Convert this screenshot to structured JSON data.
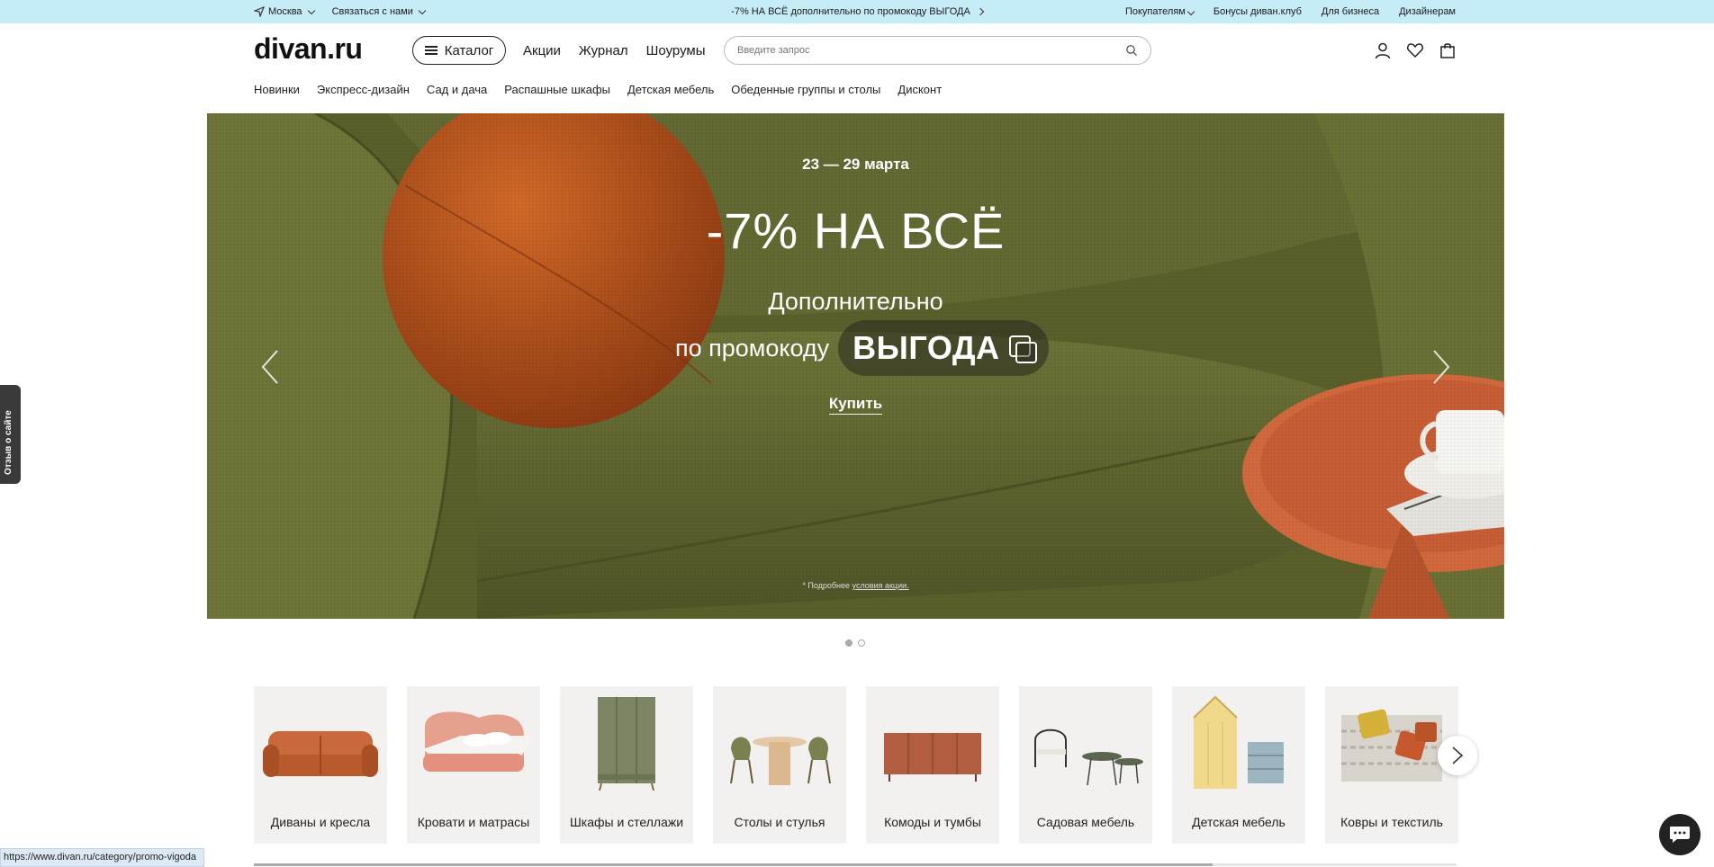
{
  "topbar": {
    "city": "Москва",
    "contact": "Связаться с нами",
    "promo": "-7% НА ВСЁ дополнительно по промокоду ВЫГОДА",
    "links": [
      "Покупателям",
      "Бонусы диван.клуб",
      "Для бизнеса",
      "Дизайнерам"
    ]
  },
  "header": {
    "logo": "divan.ru",
    "catalog_label": "Каталог",
    "nav": [
      "Акции",
      "Журнал",
      "Шоурумы"
    ],
    "search_placeholder": "Введите запрос"
  },
  "subnav": [
    "Новинки",
    "Экспресс-дизайн",
    "Сад и дача",
    "Распашные шкафы",
    "Детская мебель",
    "Обеденные группы и столы",
    "Дисконт"
  ],
  "hero": {
    "date": "23 — 29 марта",
    "headline": "-7% НА ВСЁ",
    "line1": "Дополнительно",
    "line2_prefix": "по промокоду",
    "code": "ВЫГОДА",
    "buy_label": "Купить",
    "note_prefix": "* Подробнее",
    "note_link": "условия акции."
  },
  "categories": [
    {
      "label": "Диваны и кресла",
      "icon": "sofa-icon"
    },
    {
      "label": "Кровати и матрасы",
      "icon": "bed-icon"
    },
    {
      "label": "Шкафы и стеллажи",
      "icon": "wardrobe-icon"
    },
    {
      "label": "Столы и стулья",
      "icon": "table-chairs-icon"
    },
    {
      "label": "Комоды и тумбы",
      "icon": "dresser-icon"
    },
    {
      "label": "Садовая мебель",
      "icon": "garden-furniture-icon"
    },
    {
      "label": "Детская мебель",
      "icon": "kids-furniture-icon"
    },
    {
      "label": "Ковры и текстиль",
      "icon": "rugs-icon"
    }
  ],
  "feedback_label": "Отзыв о сайте",
  "status_url": "https://www.divan.ru/category/promo-vigoda",
  "colors": {
    "topbar": "#c6ecf8",
    "hero_fabric": "#5f6630",
    "pillow": "#c2561b",
    "table": "#d36a3d"
  }
}
